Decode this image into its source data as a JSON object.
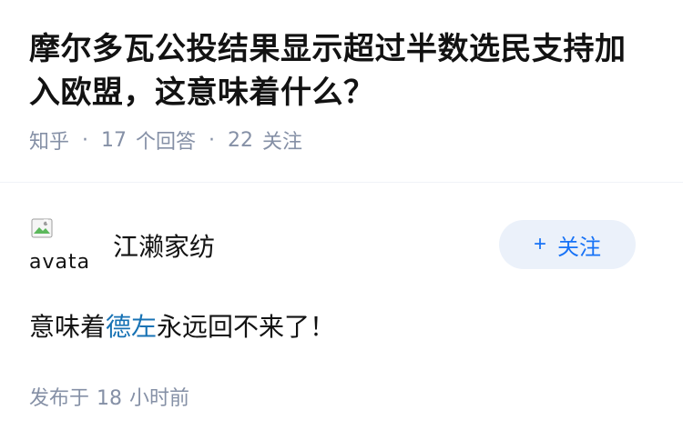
{
  "question": {
    "title": "摩尔多瓦公投结果显示超过半数选民支持加入欧盟，这意味着什么？",
    "source": "知乎",
    "answer_count": "17",
    "answer_label": "个回答",
    "follow_count": "22",
    "follow_label": "关注"
  },
  "answer": {
    "avatar_alt": "avatar",
    "author_name": "江濑家纺",
    "follow_button": "关注",
    "follow_plus": "+",
    "text_before": "意味着",
    "text_link": "德左",
    "text_after": "永远回不来了！",
    "published_label": "发布于",
    "published_number": "18",
    "published_unit": "小时前"
  },
  "colors": {
    "meta_gray": "#8590a6",
    "link_blue": "#1772b4",
    "button_bg": "#ebf1fa",
    "button_text": "#1772f6"
  }
}
